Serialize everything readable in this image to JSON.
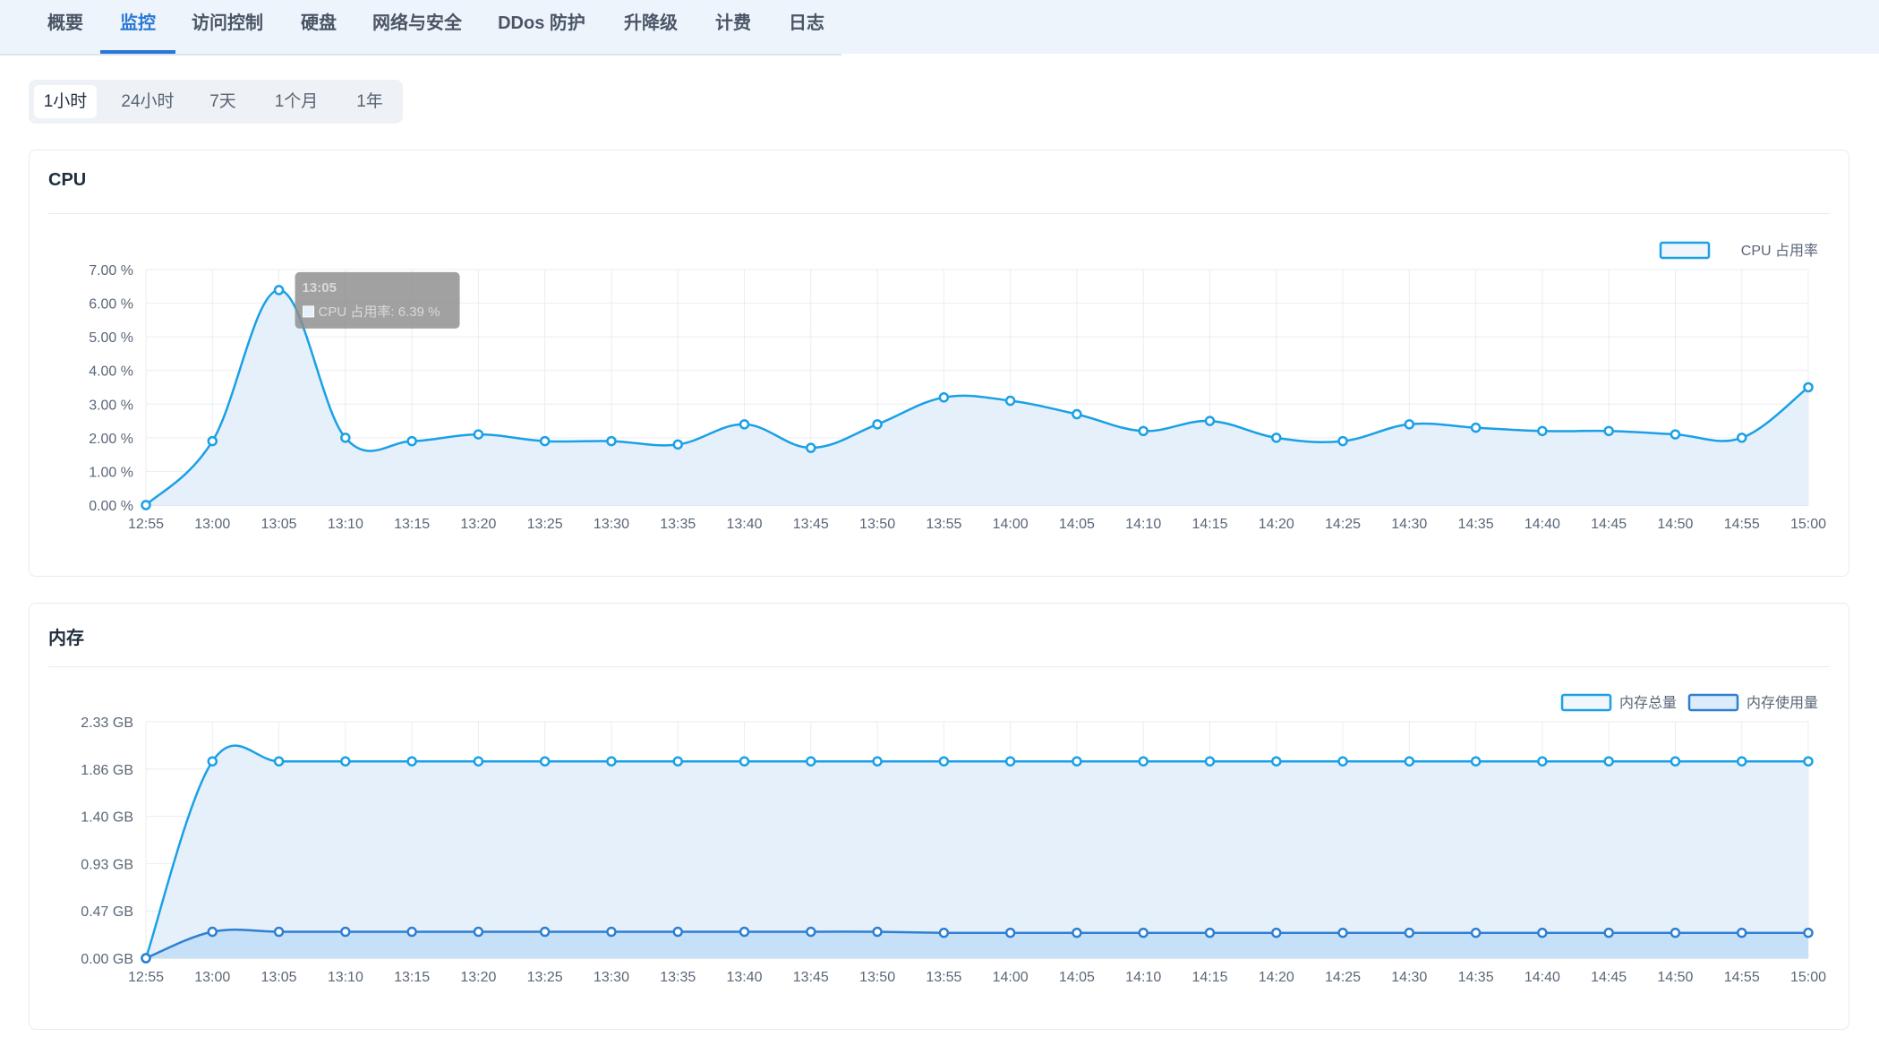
{
  "tabs": [
    {
      "label": "概要",
      "active": false
    },
    {
      "label": "监控",
      "active": true
    },
    {
      "label": "访问控制",
      "active": false
    },
    {
      "label": "硬盘",
      "active": false
    },
    {
      "label": "网络与安全",
      "active": false
    },
    {
      "label": "DDos 防护",
      "active": false
    },
    {
      "label": "升降级",
      "active": false
    },
    {
      "label": "计费",
      "active": false
    },
    {
      "label": "日志",
      "active": false
    }
  ],
  "time_ranges": [
    {
      "label": "1小时",
      "active": true
    },
    {
      "label": "24小时",
      "active": false
    },
    {
      "label": "7天",
      "active": false
    },
    {
      "label": "1个月",
      "active": false
    },
    {
      "label": "1年",
      "active": false
    }
  ],
  "cpu_card": {
    "title": "CPU"
  },
  "memory_card": {
    "title": "内存"
  },
  "colors": {
    "accent": "#2a78d6",
    "cpu_line": "#1aa0e6",
    "mem_total_line": "#1aa0e6",
    "mem_used_line": "#2d7fd2",
    "area_fill": "#e6f0fa",
    "used_fill": "#c5e0f7"
  },
  "chart_data": [
    {
      "type": "area",
      "title": "",
      "x": [
        "12:55",
        "13:00",
        "13:05",
        "13:10",
        "13:15",
        "13:20",
        "13:25",
        "13:30",
        "13:35",
        "13:40",
        "13:45",
        "13:50",
        "13:55",
        "14:00",
        "14:05",
        "14:10",
        "14:15",
        "14:20",
        "14:25",
        "14:30",
        "14:35",
        "14:40",
        "14:45",
        "14:50",
        "14:55",
        "15:00"
      ],
      "series": [
        {
          "name": "CPU 占用率",
          "values": [
            0.0,
            1.9,
            6.39,
            2.0,
            1.9,
            2.1,
            1.9,
            1.9,
            1.8,
            2.4,
            1.7,
            2.4,
            3.2,
            3.1,
            2.7,
            2.2,
            2.5,
            2.0,
            1.9,
            2.4,
            2.3,
            2.2,
            2.2,
            2.1,
            2.0,
            3.5
          ]
        }
      ],
      "yticks": [
        "0.00 %",
        "1.00 %",
        "2.00 %",
        "3.00 %",
        "4.00 %",
        "5.00 %",
        "6.00 %",
        "7.00 %"
      ],
      "ylim": [
        0,
        7
      ],
      "legend": "top-right",
      "grid": true,
      "tooltip": {
        "time": "13:05",
        "label": "CPU 占用率: 6.39 %",
        "index": 2
      }
    },
    {
      "type": "area",
      "title": "",
      "x": [
        "12:55",
        "13:00",
        "13:05",
        "13:10",
        "13:15",
        "13:20",
        "13:25",
        "13:30",
        "13:35",
        "13:40",
        "13:45",
        "13:50",
        "13:55",
        "14:00",
        "14:05",
        "14:10",
        "14:15",
        "14:20",
        "14:25",
        "14:30",
        "14:35",
        "14:40",
        "14:45",
        "14:50",
        "14:55",
        "15:00"
      ],
      "series": [
        {
          "name": "内存总量",
          "values": [
            0.0,
            1.94,
            1.94,
            1.94,
            1.94,
            1.94,
            1.94,
            1.94,
            1.94,
            1.94,
            1.94,
            1.94,
            1.94,
            1.94,
            1.94,
            1.94,
            1.94,
            1.94,
            1.94,
            1.94,
            1.94,
            1.94,
            1.94,
            1.94,
            1.94,
            1.94
          ]
        },
        {
          "name": "内存使用量",
          "values": [
            0.0,
            0.26,
            0.26,
            0.26,
            0.26,
            0.26,
            0.26,
            0.26,
            0.26,
            0.26,
            0.26,
            0.26,
            0.25,
            0.25,
            0.25,
            0.25,
            0.25,
            0.25,
            0.25,
            0.25,
            0.25,
            0.25,
            0.25,
            0.25,
            0.25,
            0.25
          ]
        }
      ],
      "yticks": [
        "0.00 GB",
        "0.47 GB",
        "0.93 GB",
        "1.40 GB",
        "1.86 GB",
        "2.33 GB"
      ],
      "ylim": [
        0,
        2.33
      ],
      "legend": "top-right",
      "grid": true
    }
  ]
}
